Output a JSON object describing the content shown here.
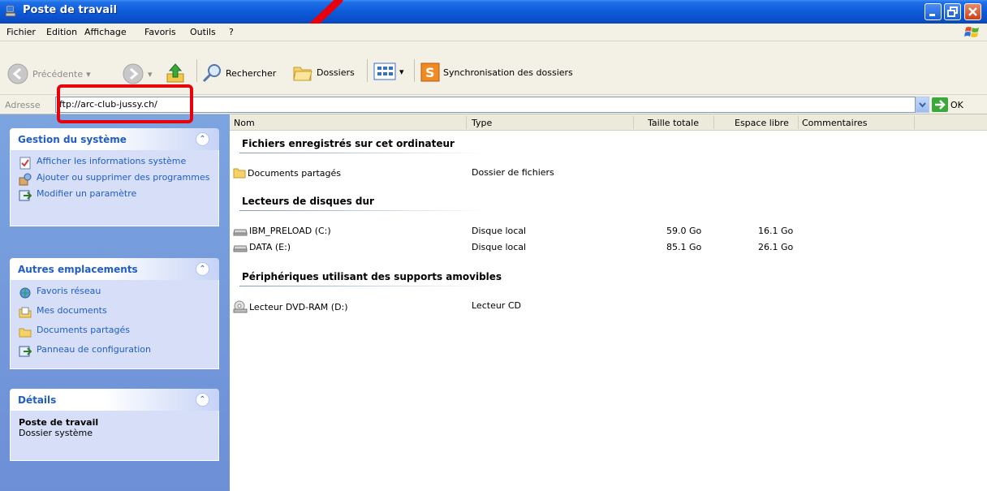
{
  "window": {
    "title": "Poste de travail"
  },
  "menu": [
    "Fichier",
    "Edition",
    "Affichage",
    "Favoris",
    "Outils",
    "?"
  ],
  "toolbar": {
    "back_label": "Précédente",
    "search_label": "Rechercher",
    "folders_label": "Dossiers",
    "sync_label": "Synchronisation des dossiers"
  },
  "address": {
    "label": "Adresse",
    "value": "ftp://arc-club-jussy.ch/",
    "go_label": "OK"
  },
  "taskpane": {
    "system": {
      "title": "Gestion du système",
      "items": [
        "Afficher les informations système",
        "Ajouter ou supprimer des programmes",
        "Modifier un paramètre"
      ]
    },
    "places": {
      "title": "Autres emplacements",
      "items": [
        "Favoris réseau",
        "Mes documents",
        "Documents partagés",
        "Panneau de configuration"
      ]
    },
    "details": {
      "title": "Détails",
      "name": "Poste de travail",
      "type": "Dossier système"
    }
  },
  "columns": [
    "Nom",
    "Type",
    "Taille totale",
    "Espace libre",
    "Commentaires"
  ],
  "groups": [
    {
      "title": "Fichiers enregistrés sur cet ordinateur",
      "rows": [
        {
          "name": "Documents partagés",
          "type": "Dossier de fichiers",
          "total": "",
          "free": ""
        }
      ]
    },
    {
      "title": "Lecteurs de disques dur",
      "rows": [
        {
          "name": "IBM_PRELOAD (C:)",
          "type": "Disque local",
          "total": "59.0 Go",
          "free": "16.1 Go"
        },
        {
          "name": "DATA (E:)",
          "type": "Disque local",
          "total": "85.1 Go",
          "free": "26.1 Go"
        }
      ]
    },
    {
      "title": "Périphériques utilisant des supports amovibles",
      "rows": [
        {
          "name": "Lecteur DVD-RAM (D:)",
          "type": "Lecteur CD",
          "total": "",
          "free": ""
        }
      ]
    }
  ],
  "colors": {
    "titlebar": "#0d5ad8",
    "taskpane": "#7ba4e0",
    "task_link": "#215dc6",
    "annotation": "#e8000b"
  }
}
